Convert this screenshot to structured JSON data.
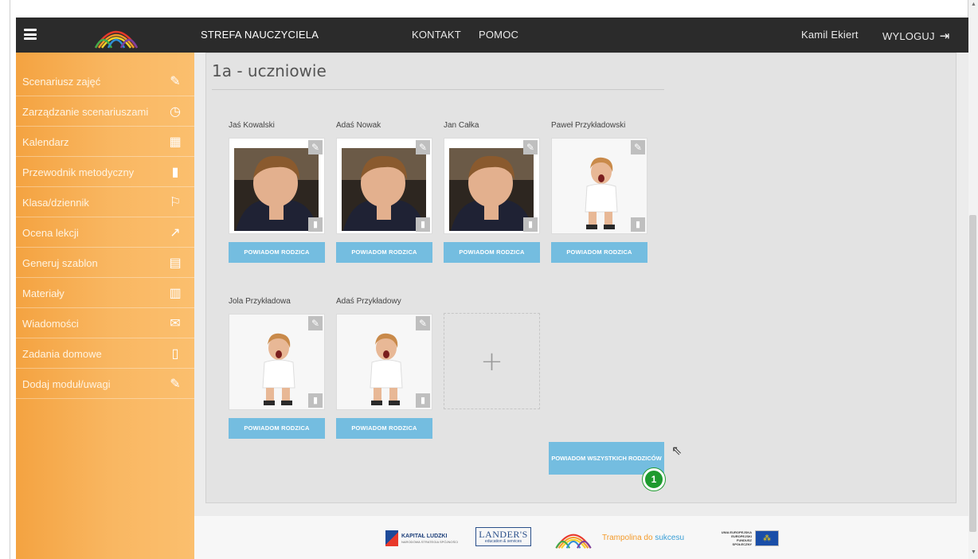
{
  "header": {
    "menu_icon": "hamburger-icon",
    "logo_icon": "rainbow-arches-logo",
    "nav_strefa": "STREFA NAUCZYCIELA",
    "nav_kontakt": "KONTAKT",
    "nav_pomoc": "POMOC",
    "user_name": "Kamil Ekiert",
    "logout_label": "WYLOGUJ",
    "logout_icon": "logout-arrow-icon"
  },
  "sidebar": {
    "items": [
      {
        "label": "Scenariusz zajęć",
        "icon": "edit-note-icon"
      },
      {
        "label": "Zarządzanie scenariuszami",
        "icon": "compass-icon"
      },
      {
        "label": "Kalendarz",
        "icon": "calendar-icon"
      },
      {
        "label": "Przewodnik metodyczny",
        "icon": "book-icon"
      },
      {
        "label": "Klasa/dziennik",
        "icon": "teacher-board-icon"
      },
      {
        "label": "Ocena lekcji",
        "icon": "chart-up-icon"
      },
      {
        "label": "Generuj szablon",
        "icon": "document-icon"
      },
      {
        "label": "Materiały",
        "icon": "film-icon"
      },
      {
        "label": "Wiadomości",
        "icon": "envelope-icon"
      },
      {
        "label": "Zadania domowe",
        "icon": "open-book-icon"
      },
      {
        "label": "Dodaj moduł/uwagi",
        "icon": "add-note-icon"
      }
    ]
  },
  "main": {
    "title": "1a - uczniowie",
    "students": [
      {
        "name": "Jaś Kowalski",
        "notify": "POWIADOM RODZICA",
        "photo": "boy-looking-down"
      },
      {
        "name": "Adaś Nowak",
        "notify": "POWIADOM RODZICA",
        "photo": "boy-looking-down"
      },
      {
        "name": "Jan Całka",
        "notify": "POWIADOM RODZICA",
        "photo": "boy-looking-down"
      },
      {
        "name": "Paweł Przykładowski",
        "notify": "POWIADOM RODZICA",
        "photo": "screaming-child"
      },
      {
        "name": "Jola Przykładowa",
        "notify": "POWIADOM RODZICA",
        "photo": "screaming-child"
      },
      {
        "name": "Adaś Przykładowy",
        "notify": "POWIADOM RODZICA",
        "photo": "screaming-child"
      }
    ],
    "add_symbol": "+",
    "notify_all": "POWIADOM WSZYSTKICH RODZICÓW",
    "step_badge": "1"
  },
  "footer": {
    "kapital": "KAPITAŁ LUDZKI",
    "kapital_sub": "NARODOWA STRATEGIA SPÓJNOŚCI",
    "lander": "LANDER'S",
    "lander_sub": "education & services",
    "trampolina_main": "Trampolina do ",
    "trampolina_accent": "sukcesu",
    "ue_text": "UNIA EUROPEJSKA EUROPEJSKI FUNDUSZ SPOŁECZNY"
  },
  "colors": {
    "topbar": "#2b2b2b",
    "sidebar_orange": "#f9b762",
    "button_blue": "#74bde0",
    "badge_green": "#1e9a2e"
  }
}
